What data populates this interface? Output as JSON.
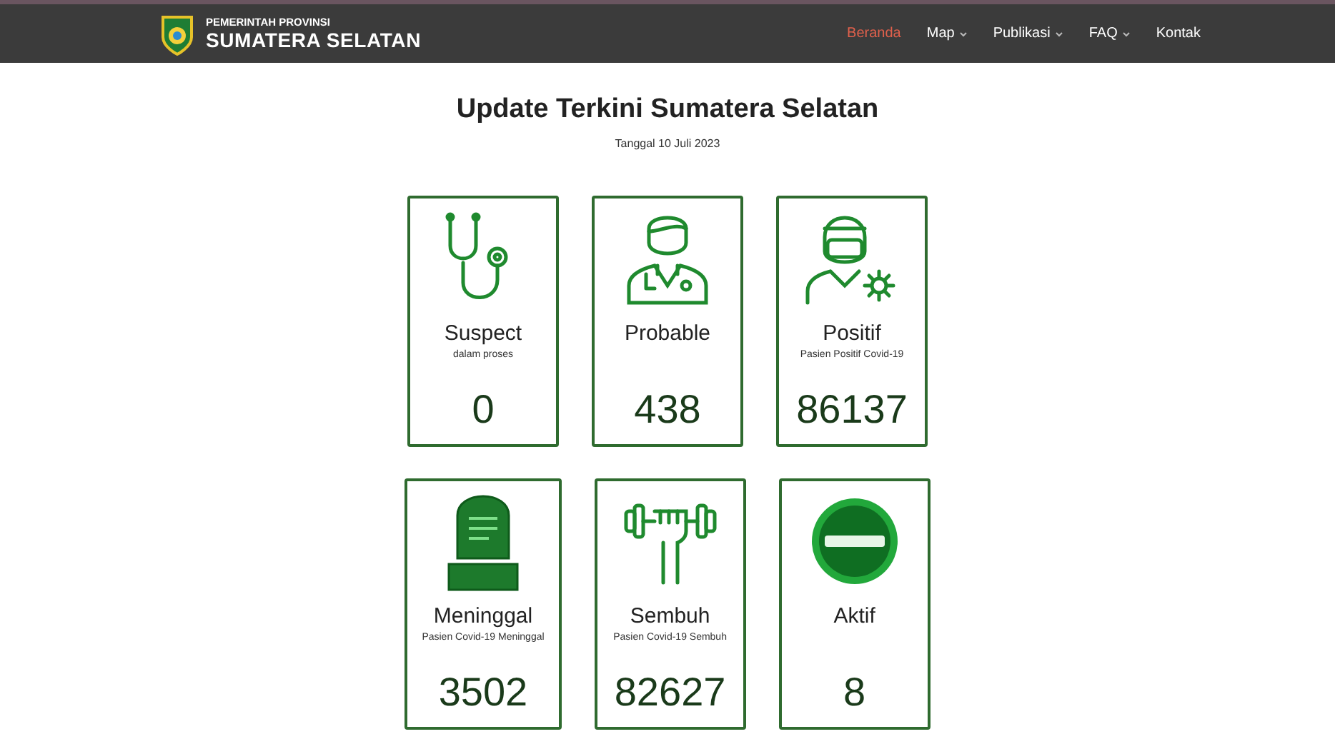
{
  "header": {
    "org_line": "PEMERINTAH PROVINSI",
    "org_name": "SUMATERA SELATAN"
  },
  "nav": [
    {
      "label": "Beranda",
      "selected": true,
      "has_menu": false
    },
    {
      "label": "Map",
      "selected": false,
      "has_menu": true
    },
    {
      "label": "Publikasi",
      "selected": false,
      "has_menu": true
    },
    {
      "label": "FAQ",
      "selected": false,
      "has_menu": true
    },
    {
      "label": "Kontak",
      "selected": false,
      "has_menu": false
    }
  ],
  "title": "Update Terkini Sumatera Selatan",
  "date": "Tanggal 10 Juli 2023",
  "rows": [
    [
      {
        "kind": "stethoscope",
        "label": "Suspect",
        "subtitle": "dalam proses",
        "value": "0"
      },
      {
        "kind": "doctor",
        "label": "Probable",
        "value": "438"
      },
      {
        "kind": "nurse",
        "label": "Positif",
        "subtitle": "Pasien Positif Covid-19",
        "value": "86137"
      }
    ],
    [
      {
        "kind": "tombstone",
        "label": "Meninggal",
        "subtitle": "Pasien Covid-19 Meninggal",
        "value": "3502"
      },
      {
        "kind": "dumbbell",
        "label": "Sembuh",
        "subtitle": "Pasien Covid-19 Sembuh",
        "value": "82627"
      },
      {
        "kind": "no-entry",
        "label": "Aktif",
        "value": "8"
      }
    ]
  ]
}
